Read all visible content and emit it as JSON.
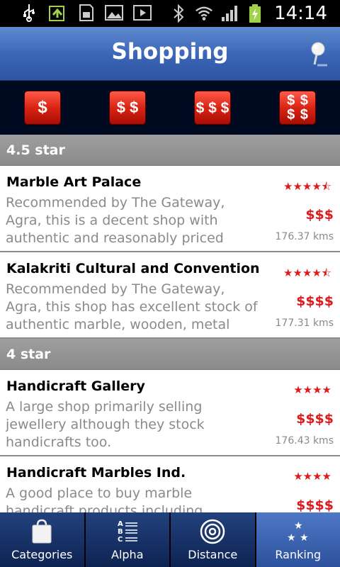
{
  "status_bar": {
    "time": "14:14"
  },
  "header": {
    "title": "Shopping"
  },
  "price_filters": [
    {
      "label": "$"
    },
    {
      "label": "$ $"
    },
    {
      "label": "$ $ $"
    },
    {
      "label": "$ $ $ $"
    }
  ],
  "sections": [
    {
      "header": "4.5 star",
      "items": [
        {
          "name": "Marble Art Palace",
          "description": "Recommended by The Gateway, Agra, this is a decent shop with authentic and reasonably priced marble",
          "stars": "★★★★⯪",
          "price": "$$$",
          "distance": "176.37 kms"
        },
        {
          "name": "Kalakriti Cultural and Convention",
          "description": "Recommended by The Gateway, Agra, this shop has excellent stock of authentic marble, wooden, metal",
          "stars": "★★★★⯪",
          "price": "$$$$",
          "distance": "177.31 kms"
        }
      ]
    },
    {
      "header": "4 star",
      "items": [
        {
          "name": "Handicraft Gallery",
          "description": "A large shop primarily selling jewellery although they stock handicrafts too.",
          "stars": "★★★★",
          "price": "$$$$",
          "distance": "176.43 kms"
        },
        {
          "name": "Handicraft Marbles Ind.",
          "description": "A good place to buy marble handicraft products including souvenirs",
          "stars": "★★★★",
          "price": "$$$$",
          "distance": ""
        }
      ]
    }
  ],
  "tabs": [
    {
      "label": "Categories",
      "icon": "shopping-bag-icon",
      "active": false
    },
    {
      "label": "Alpha",
      "icon": "alphabet-list-icon",
      "active": false
    },
    {
      "label": "Distance",
      "icon": "target-icon",
      "active": false
    },
    {
      "label": "Ranking",
      "icon": "stars-icon",
      "active": true
    }
  ],
  "colors": {
    "accent_red": "#e01a1a",
    "header_blue": "#3a64b5",
    "section_gray": "#9a9a9a"
  }
}
